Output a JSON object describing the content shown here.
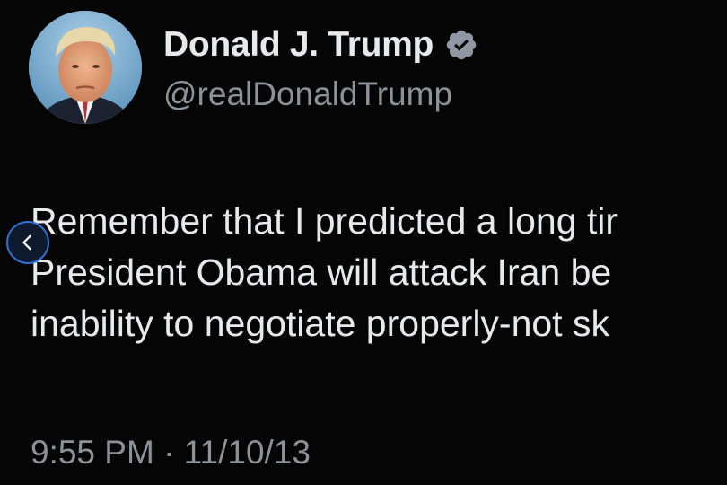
{
  "tweet": {
    "display_name": "Donald J. Trump",
    "handle": "@realDonaldTrump",
    "verified_icon": "verified-badge-icon",
    "avatar_icon": "profile-avatar",
    "text_lines": [
      "Remember that I predicted a long tir",
      "President Obama will attack Iran be",
      "inability to negotiate properly-not sk"
    ],
    "timestamp": "9:55 PM · 11/10/13"
  },
  "navigation": {
    "prev_icon": "chevron-left-icon"
  },
  "colors": {
    "background": "#050505",
    "primary_text": "#e7e9ea",
    "secondary_text": "#8b9299",
    "verified_badge": "#8e97a3",
    "nav_accent": "#2f6fd6"
  }
}
